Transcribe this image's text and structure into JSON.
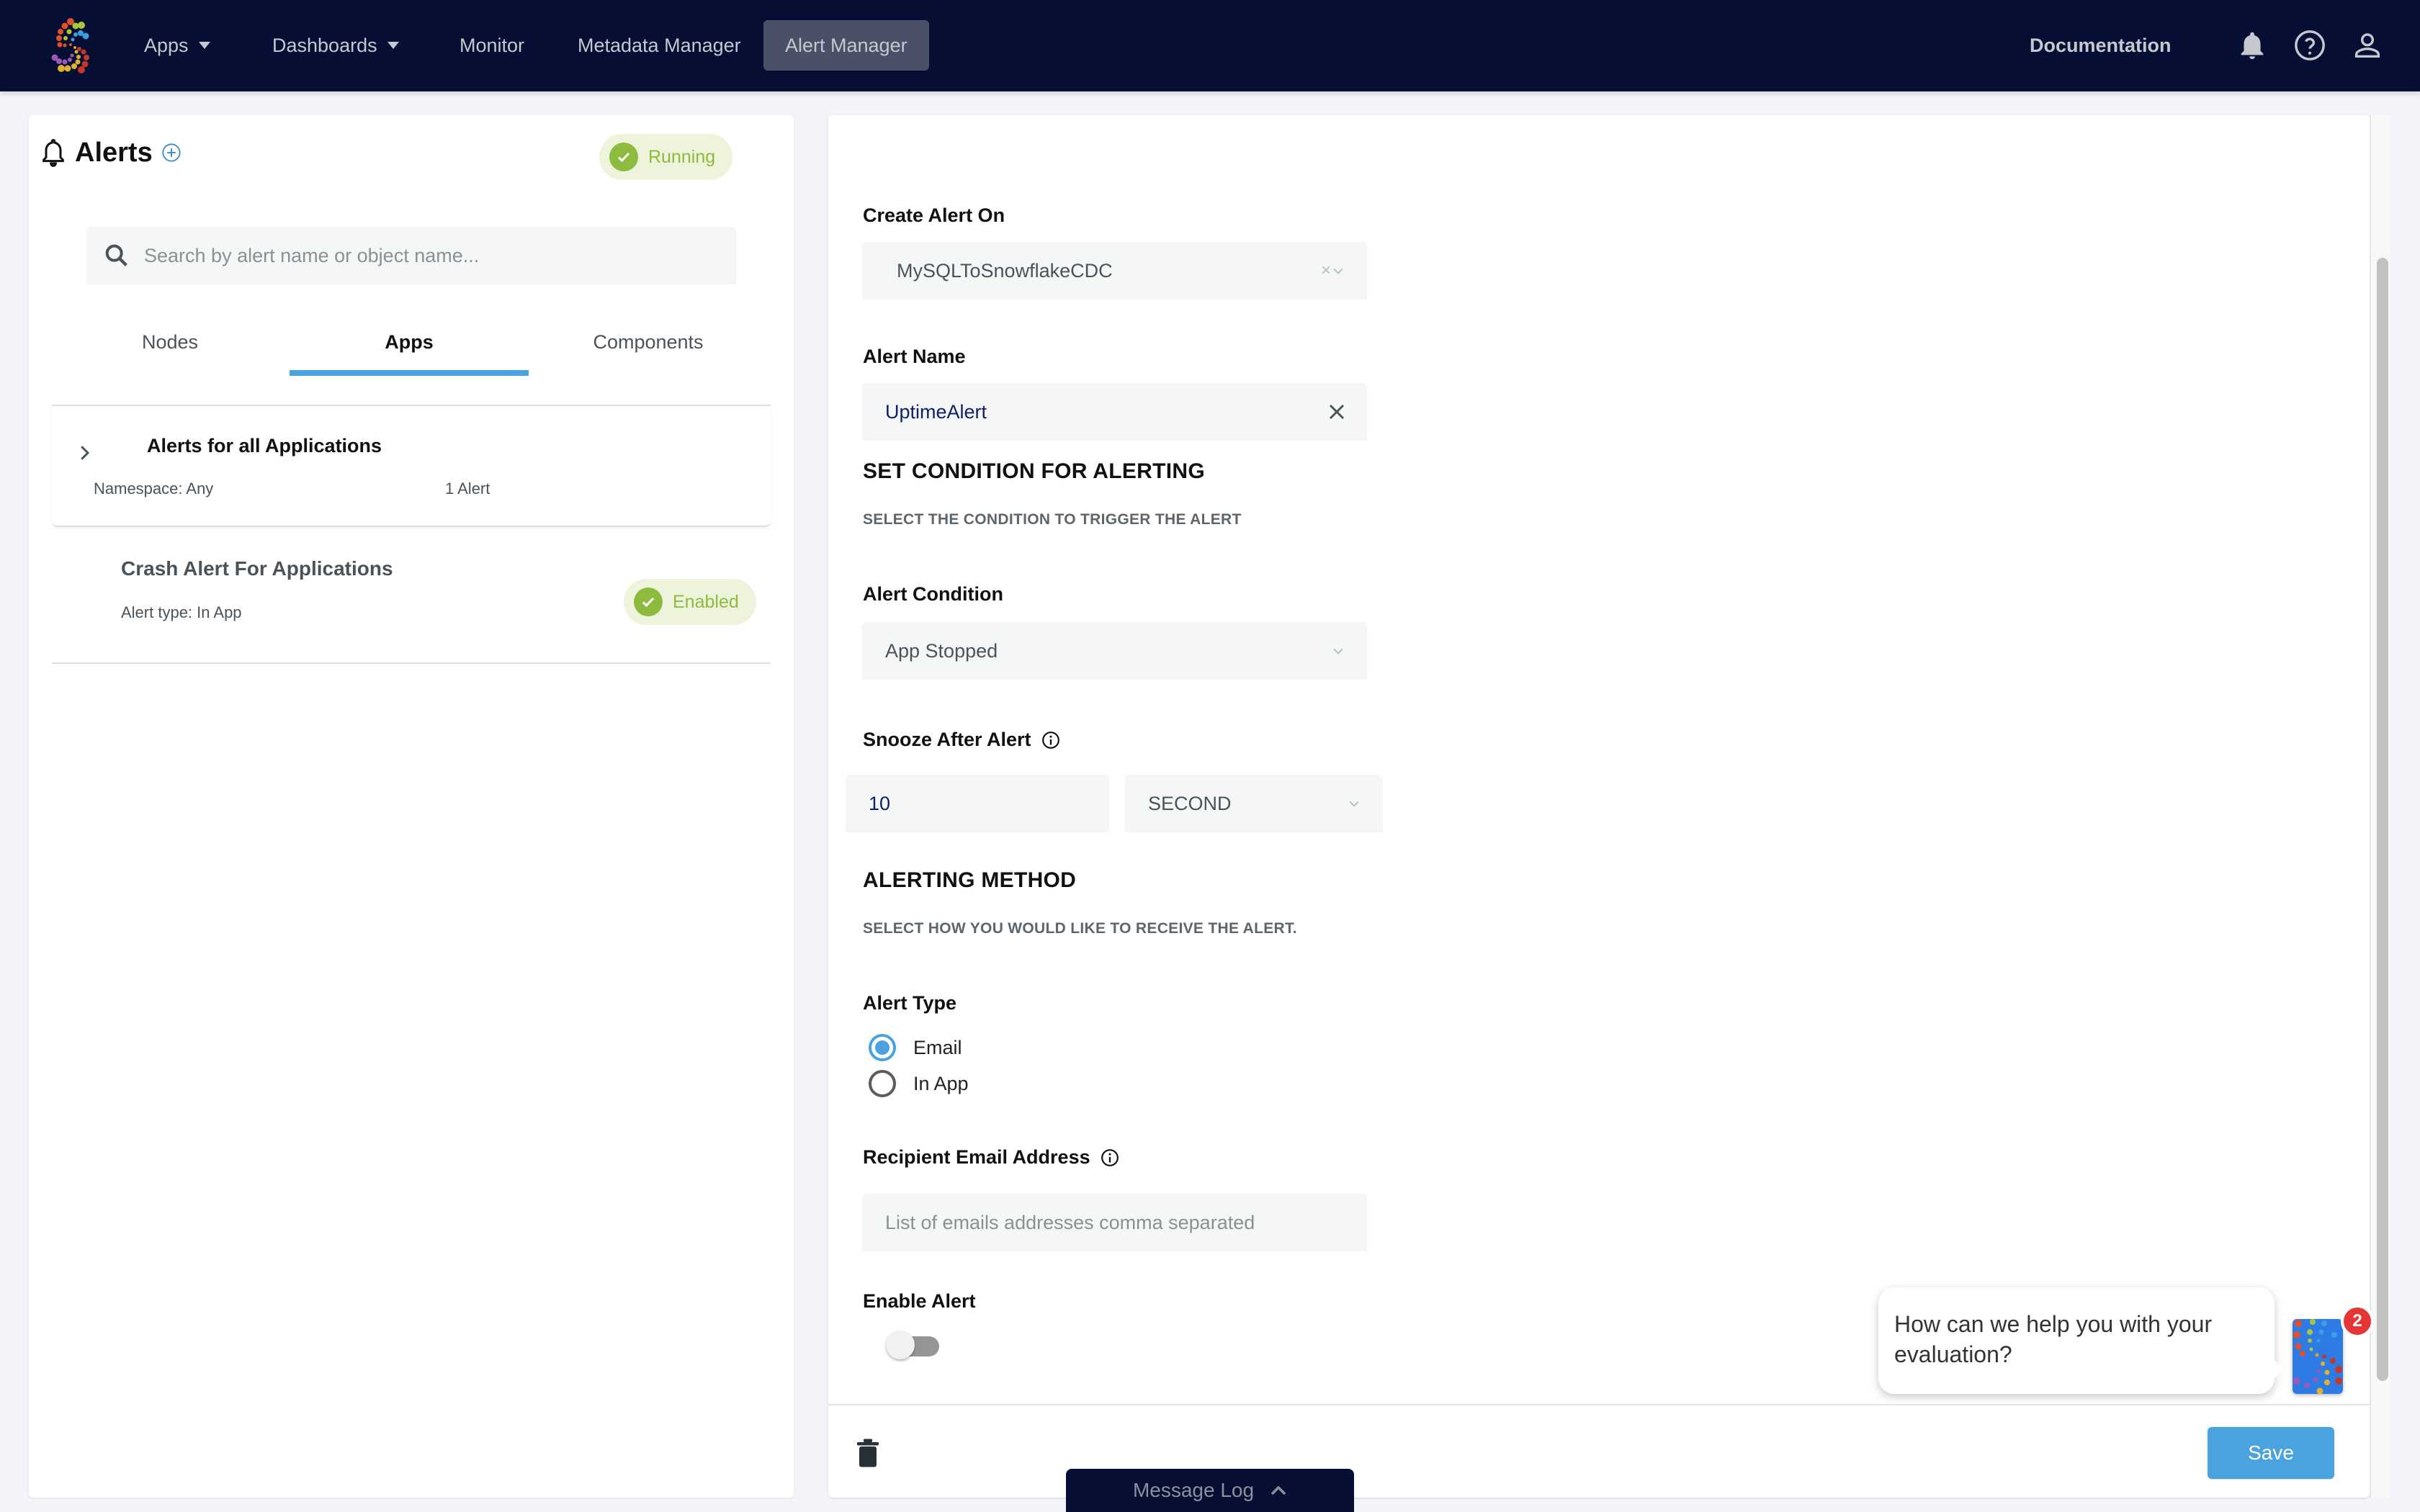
{
  "navbar": {
    "logo": "striim-logo",
    "items": [
      {
        "label": "Apps",
        "has_dropdown": true
      },
      {
        "label": "Dashboards",
        "has_dropdown": true
      },
      {
        "label": "Monitor",
        "has_dropdown": false
      },
      {
        "label": "Metadata Manager",
        "has_dropdown": false
      },
      {
        "label": "Alert Manager",
        "has_dropdown": false,
        "active": true
      }
    ],
    "documentation": "Documentation",
    "icons": [
      "bell-icon",
      "help-icon",
      "user-icon"
    ]
  },
  "left_panel": {
    "title": "Alerts",
    "status": "Running",
    "search_placeholder": "Search by alert name or object name...",
    "tabs": [
      {
        "label": "Nodes",
        "active": false
      },
      {
        "label": "Apps",
        "active": true
      },
      {
        "label": "Components",
        "active": false
      }
    ],
    "group": {
      "title": "Alerts for all Applications",
      "namespace": "Namespace: Any",
      "count": "1 Alert"
    },
    "alerts": [
      {
        "name": "Crash Alert For Applications",
        "type": "Alert type: In App",
        "status": "Enabled"
      }
    ]
  },
  "form": {
    "create_alert_on": {
      "label": "Create Alert On",
      "value": "MySQLToSnowflakeCDC"
    },
    "alert_name": {
      "label": "Alert Name",
      "value": "UptimeAlert"
    },
    "condition_section": {
      "title": "SET CONDITION FOR ALERTING",
      "subtitle": "SELECT THE CONDITION TO TRIGGER THE ALERT"
    },
    "alert_condition": {
      "label": "Alert Condition",
      "value": "App Stopped"
    },
    "snooze": {
      "label": "Snooze After Alert",
      "value": "10",
      "unit": "SECOND"
    },
    "method_section": {
      "title": "ALERTING METHOD",
      "subtitle": "SELECT HOW YOU WOULD LIKE TO RECEIVE THE ALERT."
    },
    "alert_type": {
      "label": "Alert Type",
      "options": [
        {
          "label": "Email",
          "selected": true
        },
        {
          "label": "In App",
          "selected": false
        }
      ]
    },
    "recipient": {
      "label": "Recipient Email Address",
      "placeholder": "List of emails addresses comma separated",
      "value": ""
    },
    "enable_alert": {
      "label": "Enable Alert",
      "enabled": false
    },
    "save_label": "Save"
  },
  "message_log": {
    "label": "Message Log"
  },
  "chat": {
    "message": "How can we help you with your evaluation?",
    "badge_count": "2"
  },
  "colors": {
    "navbar": "#060e33",
    "accent": "#4aa3df",
    "success": "#8dbb3d",
    "badge": "#e53535"
  }
}
